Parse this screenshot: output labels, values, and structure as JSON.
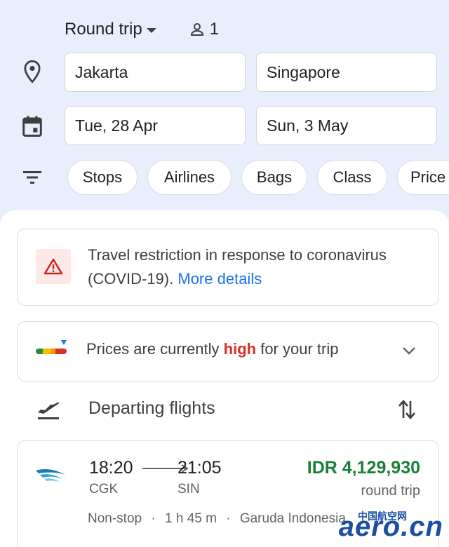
{
  "search": {
    "trip_type": "Round trip",
    "passengers": "1",
    "origin": "Jakarta",
    "destination": "Singapore",
    "depart_date": "Tue, 28 Apr",
    "return_date": "Sun, 3 May"
  },
  "filters": [
    "Stops",
    "Airlines",
    "Bags",
    "Class",
    "Price"
  ],
  "covid": {
    "text": "Travel restriction in response to coronavirus (COVID-19).",
    "link": "More details"
  },
  "price_insight": {
    "prefix": "Prices are currently",
    "level": "high",
    "suffix": "for your trip"
  },
  "departing": {
    "title": "Departing flights"
  },
  "flight": {
    "depart_time": "18:20",
    "arrive_time": "21:05",
    "from": "CGK",
    "to": "SIN",
    "price": "IDR 4,129,930",
    "price_note": "round trip",
    "stops": "Non-stop",
    "duration": "1 h 45 m",
    "airline": "Garuda Indonesia"
  },
  "watermark": {
    "cn": "中国航空网",
    "en": "aero.cn"
  },
  "colors": {
    "header_bg": "#e8eefb",
    "price_green": "#188038",
    "high_red": "#d93025",
    "link_blue": "#1a73e8"
  }
}
